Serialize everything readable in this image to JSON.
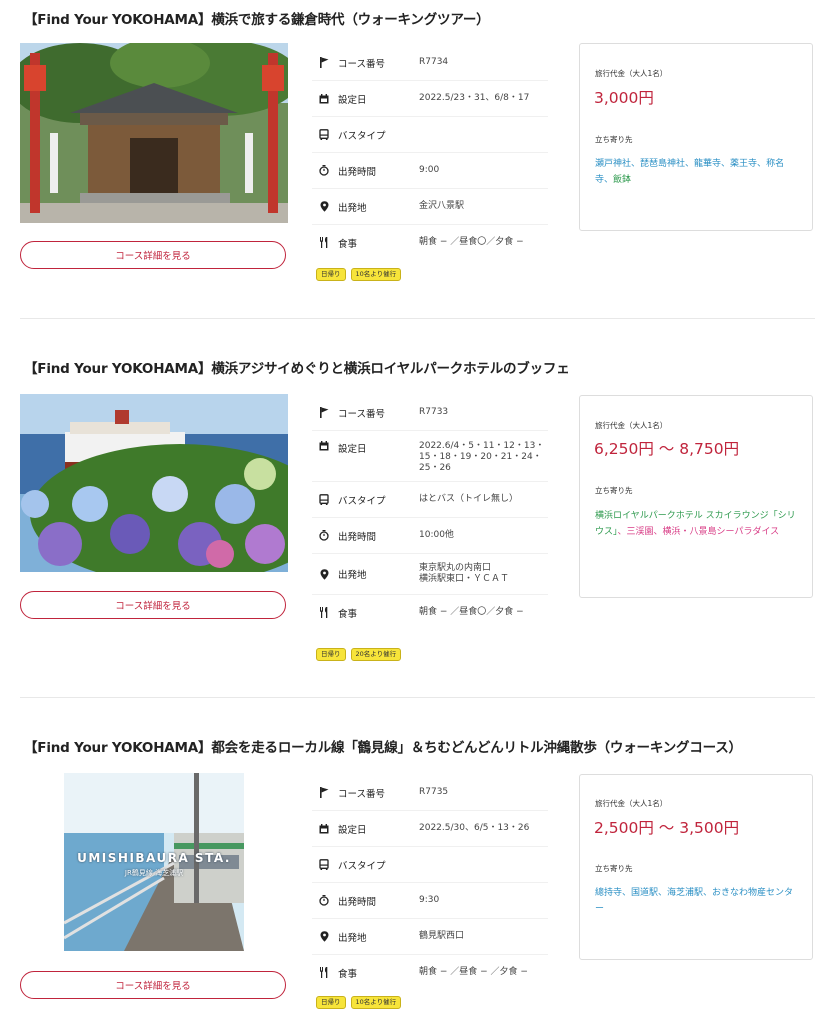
{
  "colors": {
    "accent": "#c0243c",
    "link": "#2a8fc4",
    "green": "#2e9a4e",
    "pink": "#d83c86",
    "badge": "#f7e43a"
  },
  "labels": {
    "course_no": "コース番号",
    "date": "設定日",
    "bus": "バスタイプ",
    "depart_time": "出発時間",
    "depart_place": "出発地",
    "meal": "食事",
    "price_label": "旅行代金（大人1名）",
    "stops_label": "立ち寄り先",
    "detail_button": "コース詳細を見る"
  },
  "icons": [
    "flag-icon",
    "calendar-icon",
    "bus-icon",
    "stopwatch-icon",
    "location-pin-icon",
    "cutlery-icon"
  ],
  "tours": [
    {
      "title": "【Find Your YOKOHAMA】横浜で旅する鎌倉時代（ウォーキングツアー）",
      "course_no": "R7734",
      "date": "2022.5/23・31、6/8・17",
      "bus": "",
      "depart_time": "9:00",
      "depart_place": "金沢八景駅",
      "meal": "朝食 − ／昼食〇／夕食 −",
      "badges": [
        "日帰り",
        "10名より催行"
      ],
      "price": "3,000円",
      "stops": [
        {
          "text": "瀬戸神社、",
          "color": "link"
        },
        {
          "text": "琵琶島神社、",
          "color": "link"
        },
        {
          "text": "龍華寺、",
          "color": "link"
        },
        {
          "text": "薬王寺、",
          "color": "link"
        },
        {
          "text": "称名寺、",
          "color": "link"
        },
        {
          "text": "飯鉢",
          "color": "green"
        }
      ]
    },
    {
      "title": "【Find Your YOKOHAMA】横浜アジサイめぐりと横浜ロイヤルパークホテルのブッフェ",
      "course_no": "R7733",
      "date": "2022.6/4・5・11・12・13・15・18・19・20・21・24・25・26",
      "bus": "はとバス（トイレ無し）",
      "depart_time": "10:00他",
      "depart_place": "東京駅丸の内南口\n横浜駅東口・ＹＣＡＴ",
      "meal": "朝食 − ／昼食〇／夕食 −",
      "badges": [
        "日帰り",
        "20名より催行"
      ],
      "price": "6,250円 〜 8,750円",
      "stops": [
        {
          "text": "横浜ロイヤルパークホテル スカイラウンジ「シリウス」",
          "color": "green"
        },
        {
          "text": "、三渓園、",
          "color": "pink"
        },
        {
          "text": "横浜・八景島シーパラダイス",
          "color": "pink"
        }
      ]
    },
    {
      "title": "【Find Your YOKOHAMA】都会を走るローカル線「鶴見線」＆ちむどんどんリトル沖縄散歩（ウォーキングコース）",
      "course_no": "R7735",
      "date": "2022.5/30、6/5・13・26",
      "bus": "",
      "depart_time": "9:30",
      "depart_place": "鶴見駅西口",
      "meal": "朝食 − ／昼食 − ／夕食 −",
      "badges": [
        "日帰り",
        "10名より催行"
      ],
      "price": "2,500円 〜 3,500円",
      "stops": [
        {
          "text": "總持寺、",
          "color": "link"
        },
        {
          "text": "国道駅、",
          "color": "link"
        },
        {
          "text": "海芝浦駅、",
          "color": "link"
        },
        {
          "text": "おきなわ物産センター",
          "color": "link"
        }
      ],
      "photo_text": {
        "main": "UMISHIBAURA STA.",
        "sub": "JR鶴見線 海芝浦駅"
      }
    }
  ]
}
